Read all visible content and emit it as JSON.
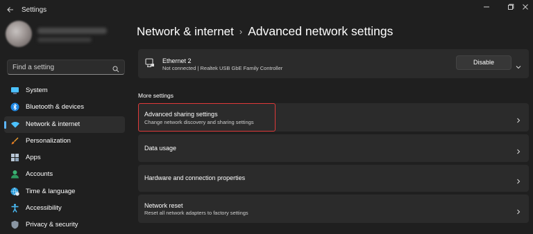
{
  "window": {
    "title": "Settings"
  },
  "search": {
    "placeholder": "Find a setting"
  },
  "sidebar": {
    "items": [
      {
        "label": "System",
        "icon": "monitor-icon"
      },
      {
        "label": "Bluetooth & devices",
        "icon": "bluetooth-icon"
      },
      {
        "label": "Network & internet",
        "icon": "wifi-icon",
        "active": true
      },
      {
        "label": "Personalization",
        "icon": "brush-icon"
      },
      {
        "label": "Apps",
        "icon": "apps-icon"
      },
      {
        "label": "Accounts",
        "icon": "person-icon"
      },
      {
        "label": "Time & language",
        "icon": "globe-clock-icon"
      },
      {
        "label": "Accessibility",
        "icon": "accessibility-icon"
      },
      {
        "label": "Privacy & security",
        "icon": "shield-icon"
      }
    ]
  },
  "breadcrumb": {
    "parent": "Network & internet",
    "separator": "›",
    "current": "Advanced network settings"
  },
  "ethernet": {
    "title": "Ethernet 2",
    "status": "Not connected | Realtek USB GbE Family Controller",
    "button": "Disable"
  },
  "more_settings": {
    "label": "More settings",
    "items": [
      {
        "title": "Advanced sharing settings",
        "subtitle": "Change network discovery and sharing settings"
      },
      {
        "title": "Data usage",
        "subtitle": ""
      },
      {
        "title": "Hardware and connection properties",
        "subtitle": ""
      },
      {
        "title": "Network reset",
        "subtitle": "Reset all network adapters to factory settings"
      }
    ]
  },
  "colors": {
    "accent": "#5db7ff",
    "highlight_box": "#e03a3a",
    "background": "#1f1f1f",
    "card": "#2b2b2b"
  }
}
